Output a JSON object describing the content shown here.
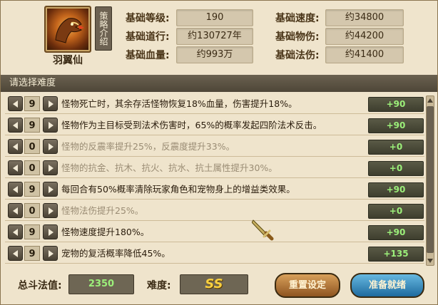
{
  "character": {
    "name": "羽翼仙",
    "strategy_label": "策略介绍"
  },
  "stats": [
    {
      "label": "基础等级:",
      "value": "190"
    },
    {
      "label": "基础速度:",
      "value": "约34800"
    },
    {
      "label": "基础道行:",
      "value": "约130727年"
    },
    {
      "label": "基础物伤:",
      "value": "约44200"
    },
    {
      "label": "基础血量:",
      "value": "约993万"
    },
    {
      "label": "基础法伤:",
      "value": "约41400"
    }
  ],
  "difficulty_header": "请选择难度",
  "options": [
    {
      "level": "9",
      "text": "怪物死亡时，其余存活怪物恢复18%血量，伤害提升18%。",
      "bonus": "+90",
      "active": true
    },
    {
      "level": "9",
      "text": "怪物作为主目标受到法术伤害时，65%的概率发起四阶法术反击。",
      "bonus": "+90",
      "active": true
    },
    {
      "level": "0",
      "text": "怪物的反震率提升25%，反震度提升33%。",
      "bonus": "+0",
      "active": false
    },
    {
      "level": "0",
      "text": "怪物的抗金、抗木、抗火、抗水、抗土属性提升30%。",
      "bonus": "+0",
      "active": false
    },
    {
      "level": "9",
      "text": "每回合有50%概率清除玩家角色和宠物身上的增益类效果。",
      "bonus": "+90",
      "active": true
    },
    {
      "level": "0",
      "text": "怪物法伤提升25%。",
      "bonus": "+0",
      "active": false
    },
    {
      "level": "9",
      "text": "怪物速度提升180%。",
      "bonus": "+90",
      "active": true
    },
    {
      "level": "9",
      "text": "宠物的复活概率降低45%。",
      "bonus": "+135",
      "active": true
    }
  ],
  "footer": {
    "total_label": "总斗法值:",
    "total_value": "2350",
    "rank_label": "难度:",
    "rank_value": "SS",
    "reset_label": "重置设定",
    "ready_label": "准备就绪"
  },
  "colors": {
    "bonus_text": "#9cf07a",
    "rank_text": "#f8d040"
  }
}
